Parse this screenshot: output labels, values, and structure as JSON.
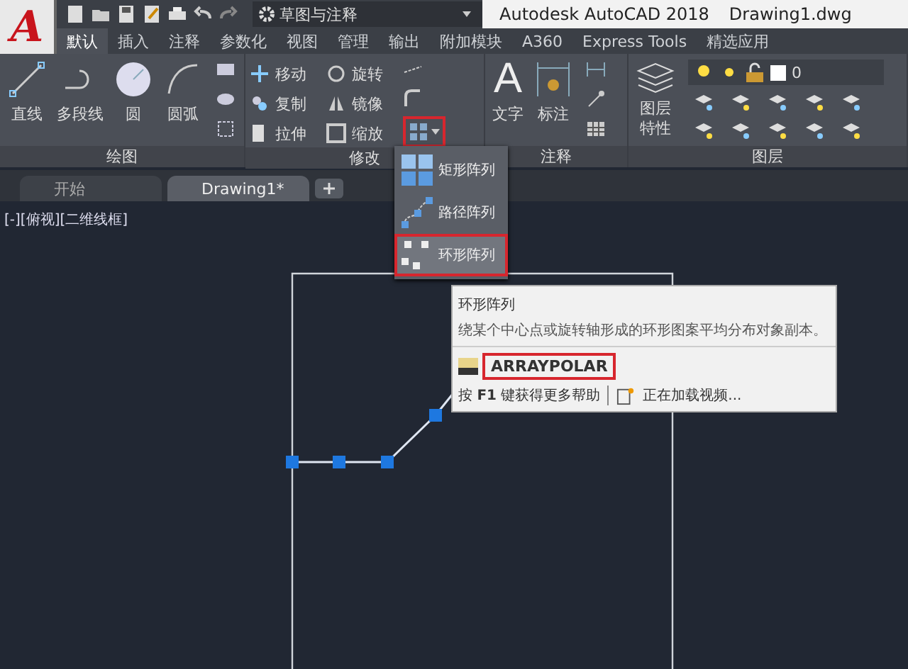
{
  "app_button": {
    "label": "A"
  },
  "workspace": {
    "label": "草图与注释"
  },
  "window": {
    "title": "Autodesk AutoCAD 2018",
    "document": "Drawing1.dwg"
  },
  "ribbon_tabs": [
    {
      "label": "默认",
      "selected": true
    },
    {
      "label": "插入",
      "selected": false
    },
    {
      "label": "注释",
      "selected": false
    },
    {
      "label": "参数化",
      "selected": false
    },
    {
      "label": "视图",
      "selected": false
    },
    {
      "label": "管理",
      "selected": false
    },
    {
      "label": "输出",
      "selected": false
    },
    {
      "label": "附加模块",
      "selected": false
    },
    {
      "label": "A360",
      "selected": false
    },
    {
      "label": "Express Tools",
      "selected": false
    },
    {
      "label": "精选应用",
      "selected": false
    }
  ],
  "draw_panel": {
    "title": "绘图",
    "tools": [
      "直线",
      "多段线",
      "圆",
      "圆弧"
    ]
  },
  "modify_panel": {
    "title": "修改",
    "tools": [
      "移动",
      "旋转",
      "复制",
      "镜像",
      "拉伸",
      "缩放"
    ],
    "array_button": {
      "highlighted": true
    }
  },
  "annotation_panel": {
    "title": "注释",
    "tools": [
      {
        "glyph": "A",
        "label": "文字"
      },
      {
        "label": "标注"
      }
    ]
  },
  "layers_panel": {
    "title": "图层",
    "tool": [
      "图层",
      "特性"
    ],
    "current_layer": "0"
  },
  "doc_tabs": [
    {
      "label": "开始",
      "selected": false
    },
    {
      "label": "Drawing1*",
      "selected": true
    }
  ],
  "viewport_label": "[-][俯视][二维线框]",
  "array_menu": [
    {
      "label": "矩形阵列",
      "selected": false
    },
    {
      "label": "路径阵列",
      "selected": false
    },
    {
      "label": "环形阵列",
      "selected": true
    }
  ],
  "tooltip": {
    "title": "环形阵列",
    "description": "绕某个中心点或旋转轴形成的环形图案平均分布对象副本。",
    "command": "ARRAYPOLAR",
    "command_highlighted": true,
    "help": "按 **F1** 键获得更多帮助",
    "video": "正在加载视频..."
  }
}
